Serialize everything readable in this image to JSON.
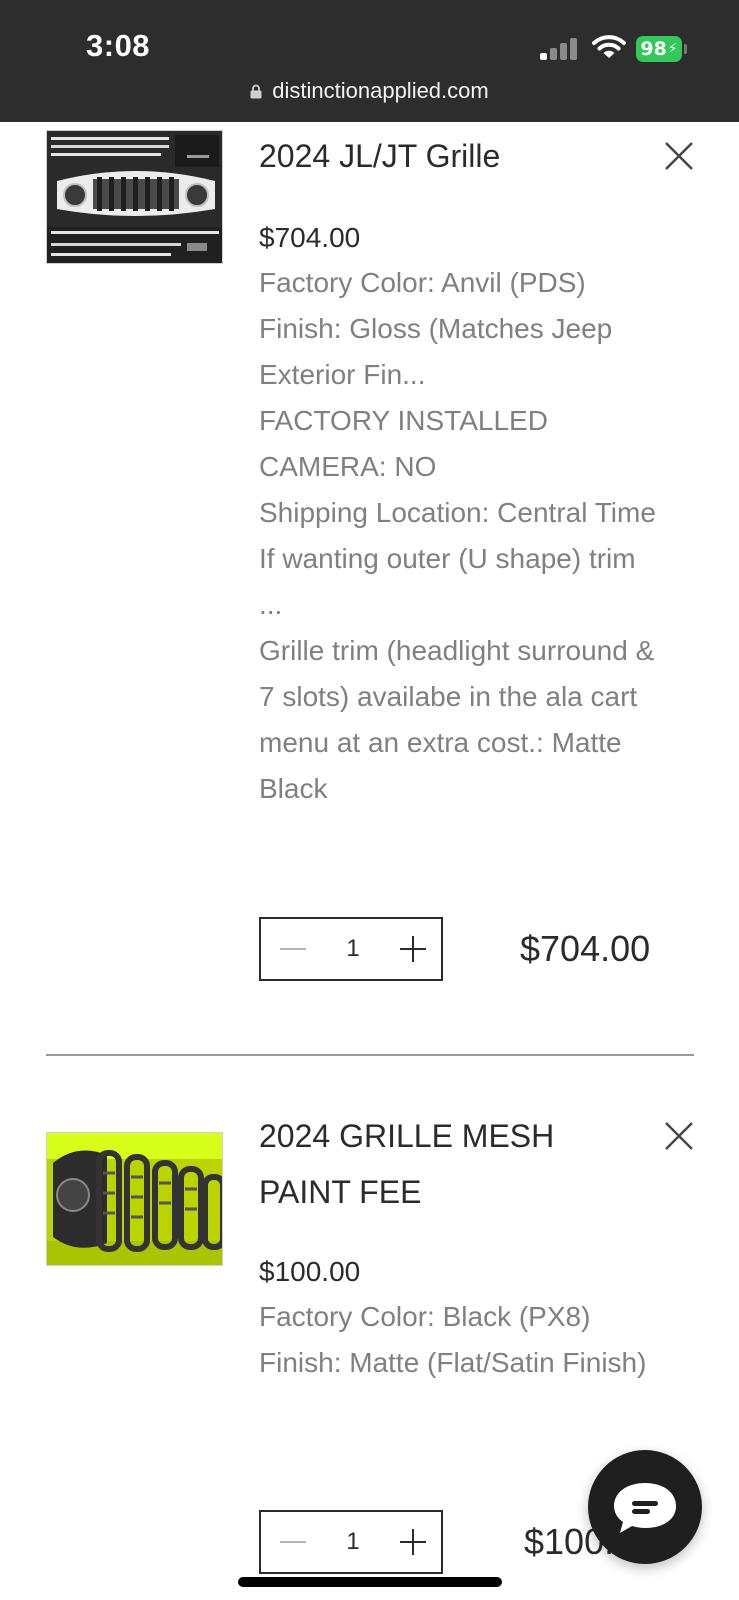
{
  "status_bar": {
    "time": "3:08",
    "battery": "98"
  },
  "browser": {
    "url": "distinctionapplied.com"
  },
  "cart_items": [
    {
      "title": "2024 JL/JT Grille",
      "price": "$704.00",
      "options": [
        "Factory Color: Anvil (PDS)",
        "Finish: Gloss (Matches Jeep Exterior Fin...",
        "FACTORY INSTALLED CAMERA: NO",
        "Shipping Location: Central Time",
        "If wanting outer (U shape) trim ...",
        "Grille trim (headlight surround & 7 slots) availabe in the ala cart menu at an extra cost.: Matte Black"
      ],
      "quantity": "1",
      "total": "$704.00"
    },
    {
      "title": "2024 GRILLE MESH PAINT FEE",
      "price": "$100.00",
      "options": [
        "Factory Color: Black (PX8)",
        "Finish: Matte (Flat/Satin Finish)"
      ],
      "quantity": "1",
      "total": "$100.00"
    }
  ],
  "icons": {
    "remove": "close-icon",
    "decrement": "minus-icon",
    "increment": "plus-icon",
    "chat": "chat-bubble-icon",
    "lock": "lock-icon"
  },
  "colors": {
    "battery": "#34c759",
    "topbar": "#2d2d2d",
    "option_text": "#808080",
    "mesh_thumb_accent": "#ccff00"
  }
}
